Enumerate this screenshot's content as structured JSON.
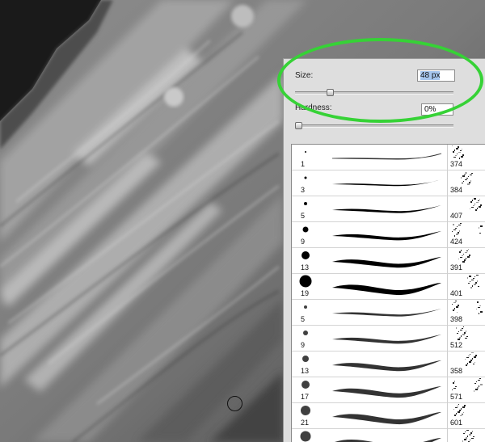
{
  "brush_panel": {
    "size_label": "Size:",
    "size_value": "48 px",
    "size_slider_level": 0.2,
    "hardness_label": "Hardness:",
    "hardness_value": "0%",
    "hardness_slider_level": 0.0
  },
  "presets": [
    {
      "size": "1",
      "count": "374",
      "dot": 1,
      "stroke": 1.2,
      "soft": false
    },
    {
      "size": "3",
      "count": "384",
      "dot": 1.5,
      "stroke": 2.5,
      "soft": false
    },
    {
      "size": "5",
      "count": "407",
      "dot": 2,
      "stroke": 4,
      "soft": false
    },
    {
      "size": "9",
      "count": "424",
      "dot": 3.5,
      "stroke": 6,
      "soft": false
    },
    {
      "size": "13",
      "count": "391",
      "dot": 5,
      "stroke": 8,
      "soft": false
    },
    {
      "size": "19",
      "count": "401",
      "dot": 7.5,
      "stroke": 10,
      "soft": false
    },
    {
      "size": "5",
      "count": "398",
      "dot": 2,
      "stroke": 4,
      "soft": true
    },
    {
      "size": "9",
      "count": "512",
      "dot": 3,
      "stroke": 6,
      "soft": true
    },
    {
      "size": "13",
      "count": "358",
      "dot": 4,
      "stroke": 8,
      "soft": true
    },
    {
      "size": "17",
      "count": "571",
      "dot": 5,
      "stroke": 9,
      "soft": true
    },
    {
      "size": "21",
      "count": "601",
      "dot": 6,
      "stroke": 10,
      "soft": true
    },
    {
      "size": "",
      "count": "",
      "dot": 6.5,
      "stroke": 11,
      "soft": true
    }
  ],
  "colors": {
    "highlight": "#36d236",
    "panel": "#dedede",
    "selection": "#a7c7ef"
  }
}
